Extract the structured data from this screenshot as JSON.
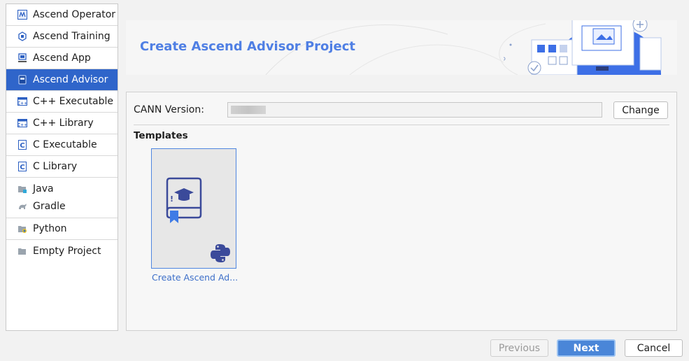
{
  "sidebar": {
    "items": [
      {
        "label": "Ascend Operator",
        "icon": "ascend-operator-icon"
      },
      {
        "label": "Ascend Training",
        "icon": "ascend-training-icon"
      },
      {
        "label": "Ascend App",
        "icon": "ascend-app-icon"
      },
      {
        "label": "Ascend Advisor",
        "icon": "ascend-advisor-icon",
        "selected": true
      },
      {
        "label": "C++ Executable",
        "icon": "cpp-executable-icon"
      },
      {
        "label": "C++ Library",
        "icon": "cpp-library-icon"
      },
      {
        "label": "C Executable",
        "icon": "c-executable-icon"
      },
      {
        "label": "C Library",
        "icon": "c-library-icon"
      }
    ],
    "java_group": {
      "java_label": "Java",
      "gradle_label": "Gradle"
    },
    "python_label": "Python",
    "empty_label": "Empty Project"
  },
  "banner": {
    "title": "Create Ascend Advisor Project"
  },
  "form": {
    "cann_label": "CANN Version:",
    "cann_value": "",
    "change_label": "Change",
    "templates_label": "Templates"
  },
  "templates": [
    {
      "label": "Create Ascend Ad...",
      "icon": "advisor-book-icon",
      "badge": "python-icon"
    }
  ],
  "footer": {
    "previous_label": "Previous",
    "next_label": "Next",
    "cancel_label": "Cancel"
  },
  "colors": {
    "accent": "#2f65ca",
    "title_blue": "#4f7fe4",
    "next_bg": "#4a86d8"
  }
}
